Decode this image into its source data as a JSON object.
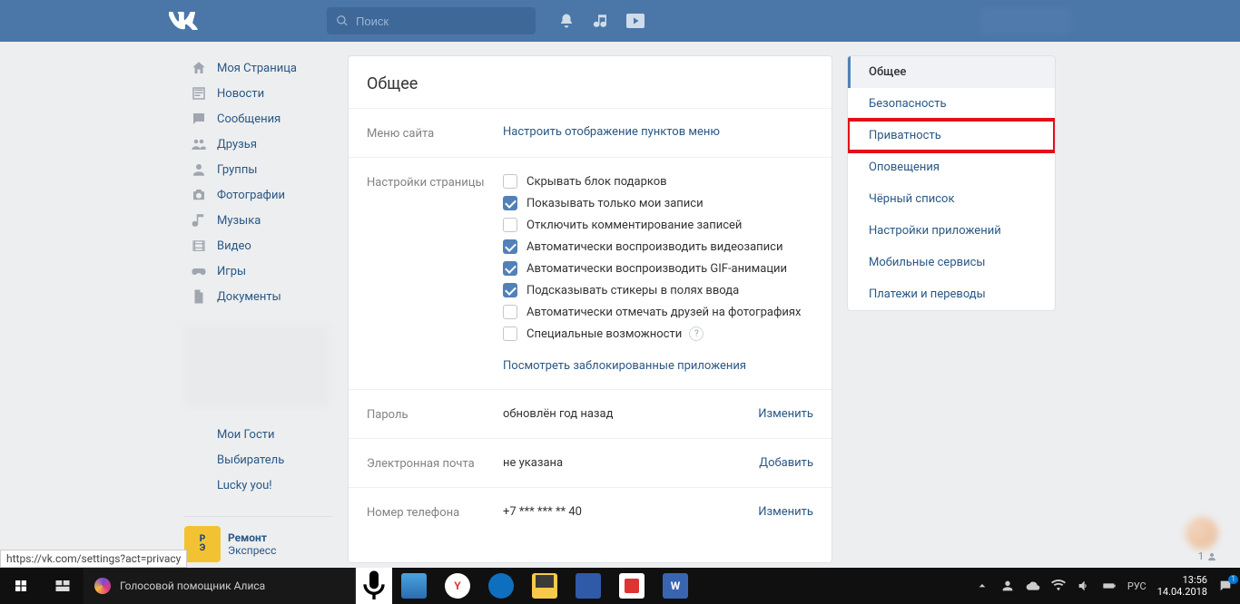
{
  "search": {
    "placeholder": "Поиск"
  },
  "nav": {
    "items": [
      {
        "icon": "home",
        "label": "Моя Страница"
      },
      {
        "icon": "news",
        "label": "Новости"
      },
      {
        "icon": "msg",
        "label": "Сообщения"
      },
      {
        "icon": "friends",
        "label": "Друзья"
      },
      {
        "icon": "groups",
        "label": "Группы"
      },
      {
        "icon": "photo",
        "label": "Фотографии"
      },
      {
        "icon": "music",
        "label": "Музыка"
      },
      {
        "icon": "video",
        "label": "Видео"
      },
      {
        "icon": "games",
        "label": "Игры"
      },
      {
        "icon": "docs",
        "label": "Документы"
      }
    ],
    "apps": [
      {
        "label": "Мои Гости"
      },
      {
        "label": "Выбиратель"
      },
      {
        "label": "Lucky you!"
      }
    ]
  },
  "ad": {
    "brand1": "Ремонт",
    "brand2": "Экспресс"
  },
  "settings": {
    "title": "Общее",
    "menu_label": "Меню сайта",
    "menu_link": "Настроить отображение пунктов меню",
    "page_settings_label": "Настройки страницы",
    "opts": [
      {
        "checked": false,
        "label": "Скрывать блок подарков"
      },
      {
        "checked": true,
        "label": "Показывать только мои записи"
      },
      {
        "checked": false,
        "label": "Отключить комментирование записей"
      },
      {
        "checked": true,
        "label": "Автоматически воспроизводить видеозаписи"
      },
      {
        "checked": true,
        "label": "Автоматически воспроизводить GIF-анимации"
      },
      {
        "checked": true,
        "label": "Подсказывать стикеры в полях ввода"
      },
      {
        "checked": false,
        "label": "Автоматически отмечать друзей на фотографиях"
      },
      {
        "checked": false,
        "label": "Специальные возможности",
        "help": true
      }
    ],
    "blocked_link": "Посмотреть заблокированные приложения",
    "rows": [
      {
        "label": "Пароль",
        "value": "обновлён год назад",
        "action": "Изменить"
      },
      {
        "label": "Электронная почта",
        "value": "не указана",
        "action": "Добавить"
      },
      {
        "label": "Номер телефона",
        "value": "+7 *** *** ** 40",
        "action": "Изменить"
      }
    ]
  },
  "side_tabs": [
    {
      "label": "Общее",
      "active": true
    },
    {
      "label": "Безопасность"
    },
    {
      "label": "Приватность",
      "highlight": true
    },
    {
      "label": "Оповещения"
    },
    {
      "label": "Чёрный список"
    },
    {
      "label": "Настройки приложений"
    },
    {
      "label": "Мобильные сервисы"
    },
    {
      "label": "Платежи и переводы"
    }
  ],
  "status_url": "https://vk.com/settings?act=privacy",
  "taskbar": {
    "assistant": "Голосовой помощник Алиса",
    "lang": "РУС",
    "time": "13:56",
    "date": "14.04.2018",
    "notif": "1"
  },
  "float_count": "1"
}
